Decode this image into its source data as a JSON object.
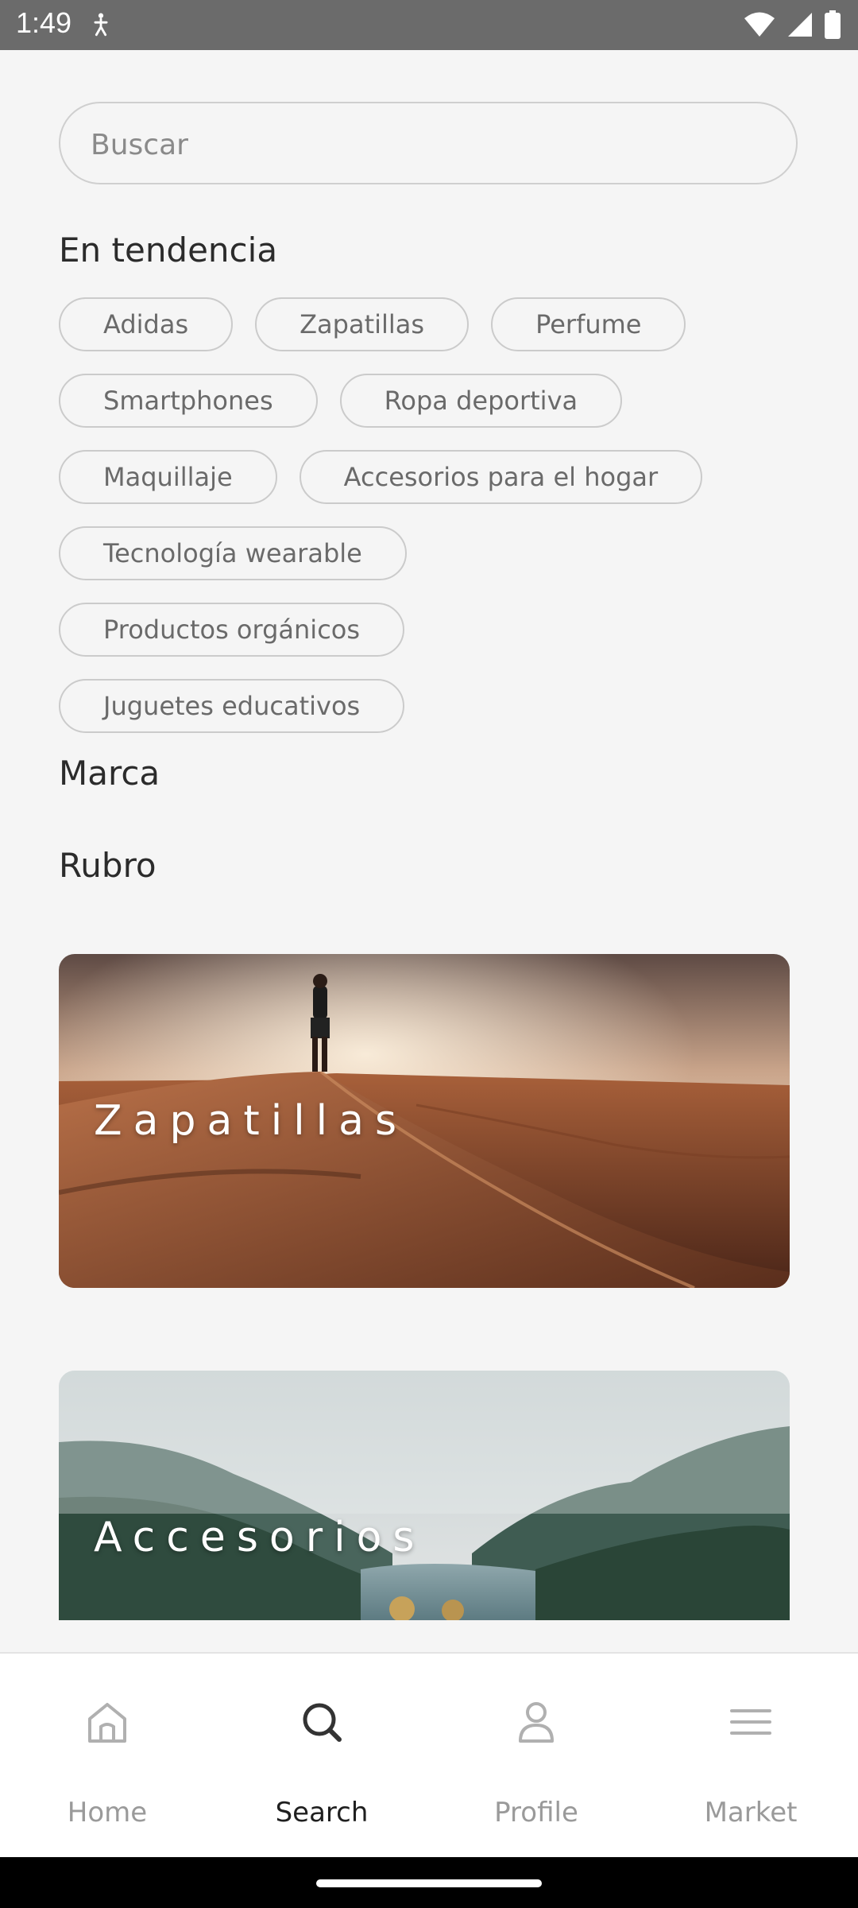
{
  "status_bar": {
    "time": "1:49"
  },
  "search": {
    "placeholder": "Buscar",
    "value": ""
  },
  "trending": {
    "title": "En tendencia",
    "rows": [
      [
        "Adidas",
        "Zapatillas",
        "Perfume"
      ],
      [
        "Smartphones",
        "Ropa deportiva"
      ],
      [
        "Maquillaje",
        "Accesorios para el hogar"
      ],
      [
        "Tecnología wearable"
      ],
      [
        "Productos orgánicos"
      ],
      [
        "Juguetes educativos"
      ]
    ]
  },
  "sections": {
    "brand": "Marca",
    "category": "Rubro"
  },
  "cards": [
    {
      "label": "Zapatillas",
      "image": "desert-dunes-hiker"
    },
    {
      "label": "Accesorios",
      "image": "mountain-lake"
    }
  ],
  "bottom_nav": {
    "active": "Search",
    "items": [
      {
        "label": "Home",
        "icon": "home-icon"
      },
      {
        "label": "Search",
        "icon": "search-icon"
      },
      {
        "label": "Profile",
        "icon": "profile-icon"
      },
      {
        "label": "Market",
        "icon": "menu-icon"
      }
    ]
  }
}
